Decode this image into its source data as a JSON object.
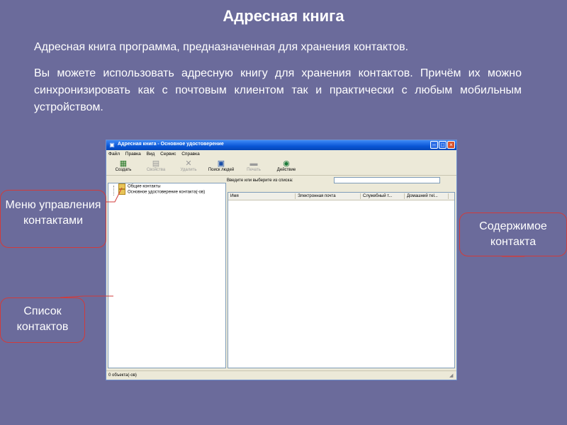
{
  "slide": {
    "title": "Адресная книга",
    "para1": "Адресная книга программа, предназначенная для хранения контактов.",
    "para2": "Вы можете использовать адресную книгу для хранения контактов. Причём их можно синхронизировать как с почтовым клиентом так и практически с любым мобильным устройством."
  },
  "window": {
    "title": "Адресная книга - Основное удостоверение",
    "menu": [
      "Файл",
      "Правка",
      "Вид",
      "Сервис",
      "Справка"
    ],
    "toolbar": [
      {
        "label": "Создать",
        "icon": "new-contact-icon",
        "enabled": true
      },
      {
        "label": "Свойства",
        "icon": "properties-icon",
        "enabled": false
      },
      {
        "label": "Удалить",
        "icon": "delete-icon",
        "enabled": false
      },
      {
        "label": "Поиск людей",
        "icon": "find-people-icon",
        "enabled": true
      },
      {
        "label": "Печать",
        "icon": "print-icon",
        "enabled": false
      },
      {
        "label": "Действие",
        "icon": "action-icon",
        "enabled": true
      }
    ],
    "search_label": "Введите или выберите из списка:",
    "search_value": "",
    "tree": [
      "Общие контакты",
      "Основное удостоверение контакта(-ов)"
    ],
    "columns": [
      "Имя",
      "Электронная почта",
      "Служебный т...",
      "Домашний теl..."
    ],
    "status": "0 объекта(-ов)"
  },
  "callouts": {
    "menu": "Меню управления контактами",
    "list": "Список контактов",
    "content": "Содержимое контакта"
  },
  "colors": {
    "background": "#6b6b9b",
    "callout_border": "#d13b3b",
    "titlebar": "#0a56d6"
  }
}
